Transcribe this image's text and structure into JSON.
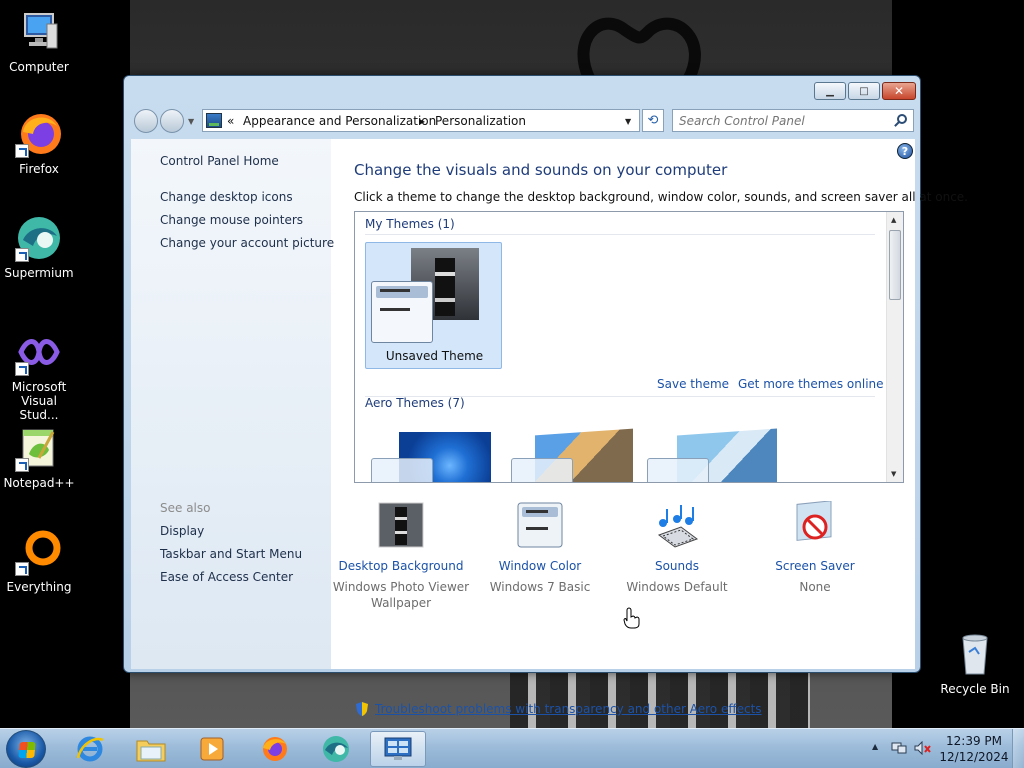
{
  "desktop": {
    "icons": [
      {
        "label": "Computer"
      },
      {
        "label": "Firefox"
      },
      {
        "label": "Supermium"
      },
      {
        "label": "Microsoft Visual Stud..."
      },
      {
        "label": "Notepad++"
      },
      {
        "label": "Everything"
      },
      {
        "label": "Recycle Bin"
      }
    ]
  },
  "window": {
    "address": {
      "overflow_chevron": "«",
      "crumb_1": "Appearance and Personalization",
      "separator": "▸",
      "crumb_2": "Personalization",
      "dropdown": "▼",
      "refresh_glyph": "⟲"
    },
    "search": {
      "placeholder": "Search Control Panel"
    },
    "buttons": {
      "minimize": "▁",
      "maximize": "□",
      "close": "✕"
    },
    "left_nav": {
      "home": "Control Panel Home",
      "links": [
        "Change desktop icons",
        "Change mouse pointers",
        "Change your account picture"
      ],
      "see_also_label": "See also",
      "see_also": [
        "Display",
        "Taskbar and Start Menu",
        "Ease of Access Center"
      ]
    },
    "main": {
      "help_glyph": "?",
      "title": "Change the visuals and sounds on your computer",
      "description": "Click a theme to change the desktop background, window color, sounds, and screen saver all at once.",
      "my_themes_header": "My Themes (1)",
      "unsaved_theme_label": "Unsaved Theme",
      "save_theme": "Save theme",
      "get_more_themes": "Get more themes online",
      "aero_themes_header": "Aero Themes (7)"
    },
    "settings": [
      {
        "link": "Desktop Background",
        "value": "Windows Photo Viewer Wallpaper"
      },
      {
        "link": "Window Color",
        "value": "Windows 7 Basic"
      },
      {
        "link": "Sounds",
        "value": "Windows Default"
      },
      {
        "link": "Screen Saver",
        "value": "None"
      }
    ],
    "troubleshoot_link": "Troubleshoot problems with transparency and other Aero effects"
  },
  "taskbar": {
    "clock_time": "12:39 PM",
    "clock_date": "12/12/2024",
    "tray_expand": "▲"
  },
  "colors": {
    "link_blue": "#1b52a8",
    "title_blue": "#1e3c7a",
    "selection": "#d4e6fa"
  }
}
